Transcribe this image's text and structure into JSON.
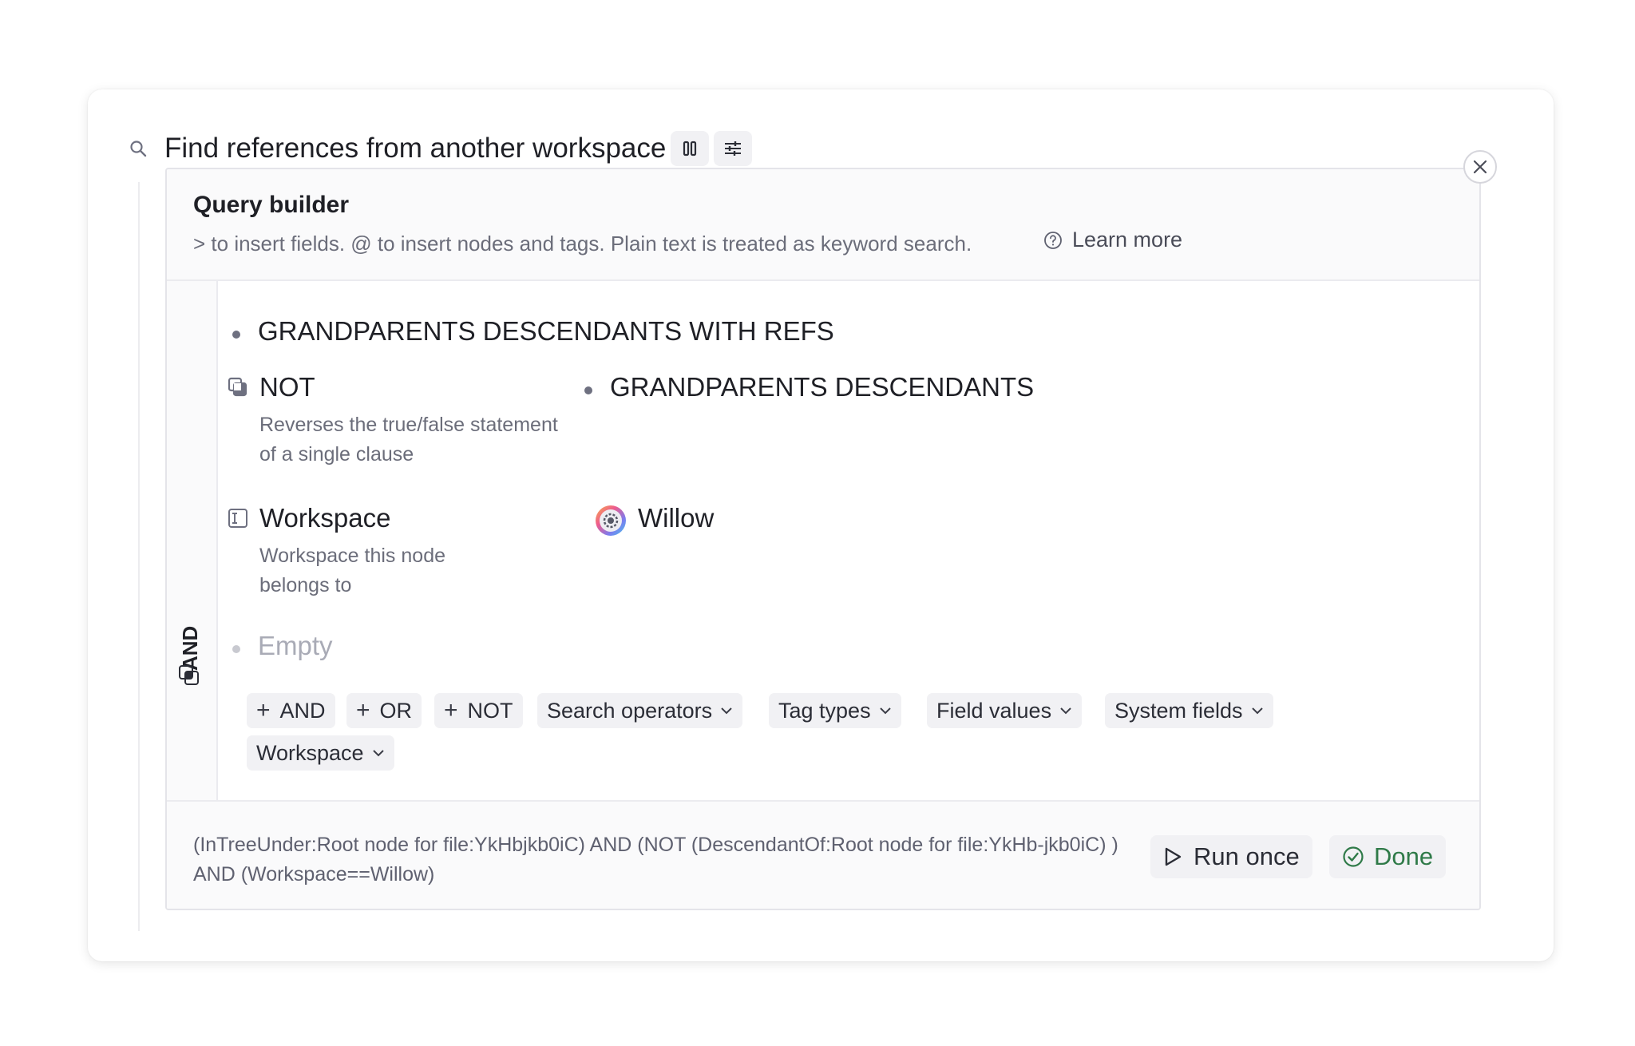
{
  "search": {
    "title": "Find references from another workspace",
    "icons": [
      "search-icon",
      "columns-icon",
      "sliders-icon",
      "close-icon"
    ]
  },
  "query_builder": {
    "title": "Query builder",
    "hint": "> to insert fields. @ to insert nodes and tags. Plain text is treated as keyword search.",
    "learn_more": "Learn more",
    "operator": "AND",
    "clauses": {
      "first": "GRANDPARENTS DESCENDANTS WITH REFS",
      "not_label": "NOT",
      "not_desc": "Reverses the true/false statement of a single clause",
      "not_value": "GRANDPARENTS DESCENDANTS",
      "workspace_label": "Workspace",
      "workspace_desc": "Workspace this node belongs to",
      "workspace_value": "Willow",
      "empty": "Empty"
    },
    "chips": {
      "and": "AND",
      "or": "OR",
      "not": "NOT",
      "search_operators": "Search operators",
      "tag_types": "Tag types",
      "field_values": "Field values",
      "system_fields": "System fields",
      "workspace": "Workspace"
    }
  },
  "footer": {
    "query": "(InTreeUnder:Root node for file:YkHbjkb0iC) AND (NOT (DescendantOf:Root node for file:YkHb-jkb0iC) ) AND (Workspace==Willow)",
    "run_once": "Run once",
    "done": "Done"
  },
  "colors": {
    "done_green": "#2f7a48",
    "chip_bg": "#f1f1f4"
  }
}
